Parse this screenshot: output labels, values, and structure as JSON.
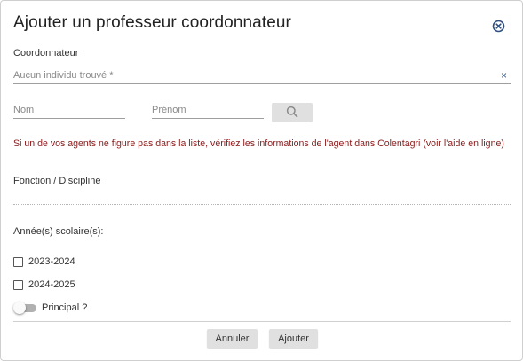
{
  "dialog": {
    "title": "Ajouter un professeur coordonnateur",
    "close_icon": "circle-x-icon"
  },
  "coordonnateur": {
    "label": "Coordonnateur",
    "placeholder": "Aucun individu trouvé *",
    "clear_icon": "×"
  },
  "search": {
    "nom_placeholder": "Nom",
    "prenom_placeholder": "Prénom",
    "search_icon": "search-icon"
  },
  "warning_text": "Si un de vos agents ne figure pas dans la liste, vérifiez les informations de l'agent dans Colentagri (voir l'aide en ligne)",
  "fonction": {
    "label": "Fonction / Discipline"
  },
  "annees": {
    "label": "Année(s) scolaire(s):",
    "options": [
      {
        "label": "2023-2024",
        "checked": false
      },
      {
        "label": "2024-2025",
        "checked": false
      }
    ]
  },
  "principal": {
    "label": "Principal ?",
    "on": false
  },
  "footer": {
    "cancel_label": "Annuler",
    "add_label": "Ajouter"
  },
  "colors": {
    "warning": "#8b1a1a",
    "accent": "#3a5a8c",
    "button_bg": "#e0e0e0"
  }
}
